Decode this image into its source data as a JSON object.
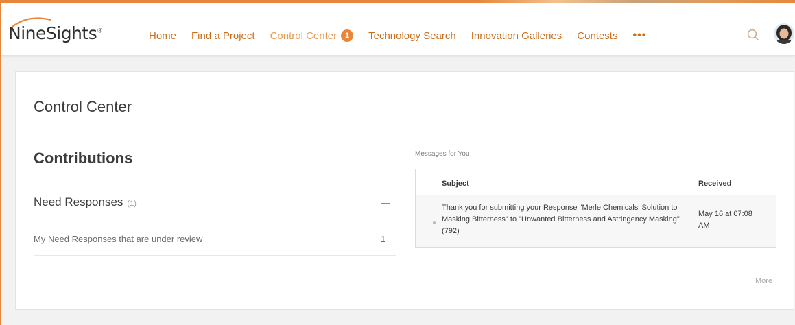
{
  "brand": {
    "logo_nine": "Nine",
    "logo_sights": "Sights",
    "logo_mark": "®",
    "accent_color": "#e8873b",
    "nav_color": "#c86f1e"
  },
  "nav": {
    "home": "Home",
    "find_project": "Find a Project",
    "control_center": "Control Center",
    "control_center_badge": "1",
    "technology_search": "Technology Search",
    "innovation_galleries": "Innovation Galleries",
    "contests": "Contests",
    "more": "•••"
  },
  "page": {
    "title": "Control Center"
  },
  "contributions": {
    "title": "Contributions",
    "need_responses_label": "Need Responses",
    "need_responses_count": "(1)",
    "row_label": "My Need Responses that are under review",
    "row_count": "1"
  },
  "messages": {
    "title": "Messages for You",
    "col_subject": "Subject",
    "col_received": "Received",
    "rows": [
      {
        "subject": "Thank you for submitting your Response \"Merle Chemicals' Solution to Masking Bitterness\" to \"Unwanted Bitterness and Astringency Masking\" (792)",
        "received": "May 16 at 07:08 AM"
      }
    ],
    "more": "More"
  },
  "icons": {
    "search": "search-icon",
    "avatar": "user-avatar",
    "collapse": "minus-icon",
    "bullet": "bullet-icon"
  }
}
